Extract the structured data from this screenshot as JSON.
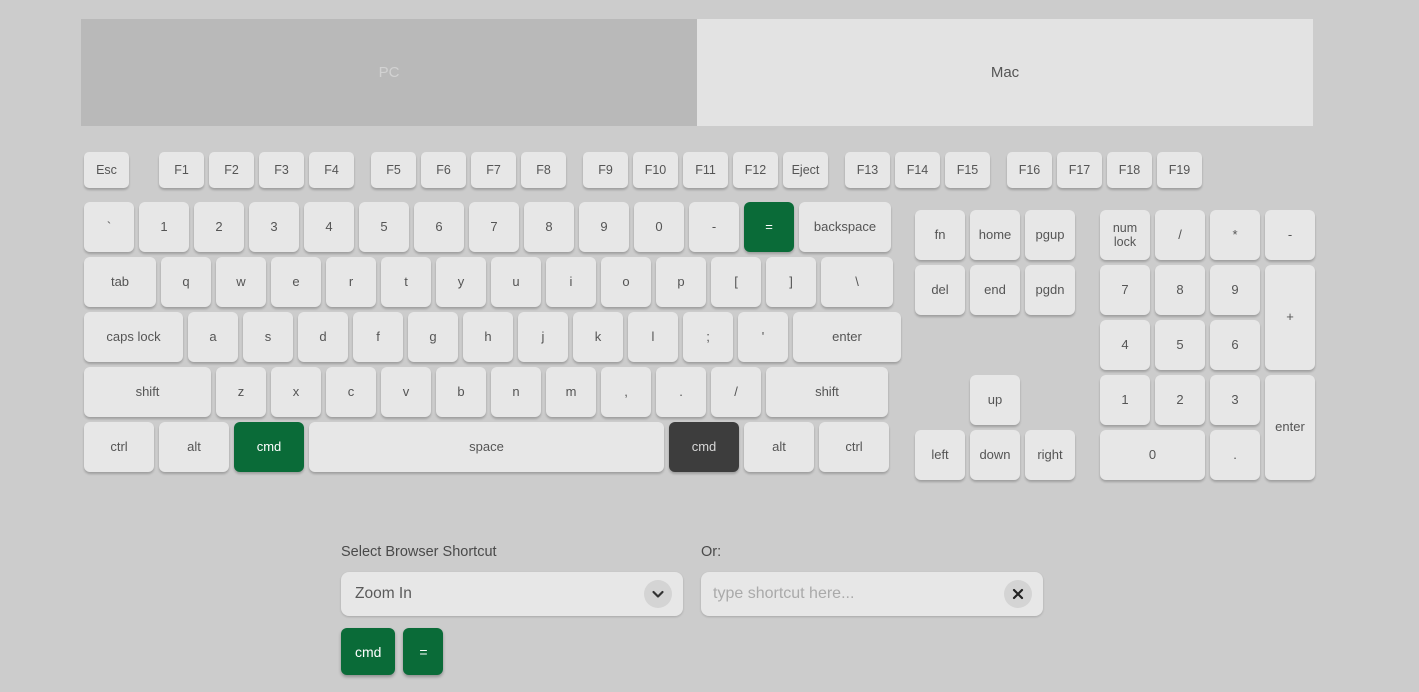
{
  "tabs": [
    {
      "label": "PC",
      "state": "inactive"
    },
    {
      "label": "Mac",
      "state": "active"
    }
  ],
  "colors": {
    "page_background": "#cccccc",
    "key_background": "#e7e7e7",
    "key_text": "#555555",
    "highlight_green": "#0a6b38",
    "pressed_gray": "#3d3d3d",
    "tab_inactive": "#b9b9b9",
    "tab_active": "#e3e3e3"
  },
  "keyboard": {
    "function_row": {
      "group1": [
        "Esc"
      ],
      "group2": [
        "F1",
        "F2",
        "F3",
        "F4"
      ],
      "group3": [
        "F5",
        "F6",
        "F7",
        "F8"
      ],
      "group4": [
        "F9",
        "F10",
        "F11",
        "F12",
        "Eject"
      ],
      "group5": [
        "F13",
        "F14",
        "F15"
      ],
      "group6": [
        "F16",
        "F17",
        "F18",
        "F19"
      ]
    },
    "number_row": [
      "`",
      "1",
      "2",
      "3",
      "4",
      "5",
      "6",
      "7",
      "8",
      "9",
      "0",
      "-",
      "=",
      "backspace"
    ],
    "qwerty_row": [
      "tab",
      "q",
      "w",
      "e",
      "r",
      "t",
      "y",
      "u",
      "i",
      "o",
      "p",
      "[",
      "]",
      "\\"
    ],
    "home_row": [
      "caps lock",
      "a",
      "s",
      "d",
      "f",
      "g",
      "h",
      "j",
      "k",
      "l",
      ";",
      "'",
      "enter"
    ],
    "shift_row": [
      "shift",
      "z",
      "x",
      "c",
      "v",
      "b",
      "n",
      "m",
      ",",
      ".",
      "/",
      "shift"
    ],
    "bottom_row": [
      "ctrl",
      "alt",
      "cmd",
      "space",
      "cmd",
      "alt",
      "ctrl"
    ],
    "nav_cluster": [
      "fn",
      "home",
      "pgup",
      "del",
      "end",
      "pgdn"
    ],
    "arrow_cluster": [
      "up",
      "left",
      "down",
      "right"
    ],
    "numpad": [
      "num lock",
      "/",
      "*",
      "-",
      "7",
      "8",
      "9",
      "+",
      "4",
      "5",
      "6",
      "1",
      "2",
      "3",
      "enter",
      "0",
      "."
    ],
    "highlighted_keys": [
      "=",
      "cmd-left"
    ],
    "pressed_keys": [
      "cmd-right"
    ]
  },
  "controls": {
    "select_label": "Select Browser Shortcut",
    "select_value": "Zoom In",
    "or_label": "Or:",
    "input_value": "",
    "input_placeholder": "type shortcut here...",
    "dropdown_icon": "chevron-down-icon",
    "clear_icon": "close-icon"
  },
  "result": {
    "keys": [
      "cmd",
      "="
    ]
  }
}
